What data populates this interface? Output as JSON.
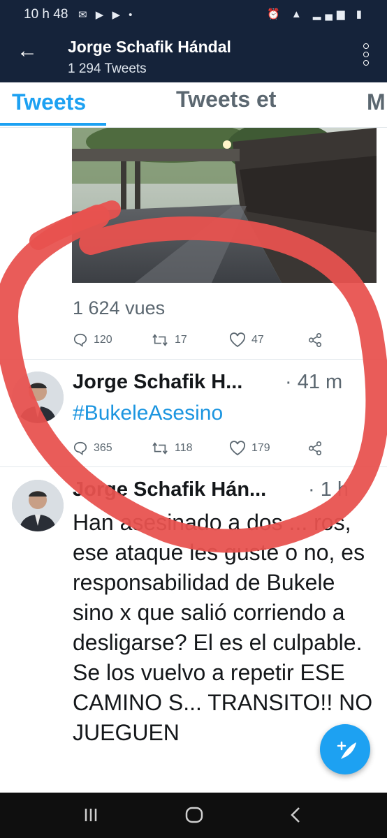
{
  "status_bar": {
    "time": "10 h 48",
    "left_icons": "✉ ▶ ▶ •",
    "right_icons": "⏰ ▲ ▂▄▆ ▮"
  },
  "header": {
    "title": "Jorge Schafik Hándal",
    "subtitle": "1 294 Tweets"
  },
  "tabs": [
    {
      "label": "Tweets",
      "active": true
    },
    {
      "label": "Tweets et"
    },
    {
      "label": "M"
    }
  ],
  "tweets": [
    {
      "views": "1 624 vues",
      "replies": "120",
      "retweets": "17",
      "likes": "47"
    },
    {
      "name": "Jorge Schafik H...",
      "time": "· 41 m",
      "text": "#BukeleAsesino",
      "replies": "365",
      "retweets": "118",
      "likes": "179"
    },
    {
      "name": "Jorge Schafik Hán...",
      "time": "· 1 h",
      "text": "Han asesinado a dos ... ros, ese ataque les guste o no, es responsabilidad de Bukele sino x que salió corriendo a desligarse? El es el culpable. Se los vuelvo a repetir ESE CAMINO S... TRANSITO!! NO JUEGUEN"
    }
  ],
  "colors": {
    "header_bg": "#15233a",
    "accent": "#1da1f2",
    "annotation_red": "#e8524f"
  }
}
